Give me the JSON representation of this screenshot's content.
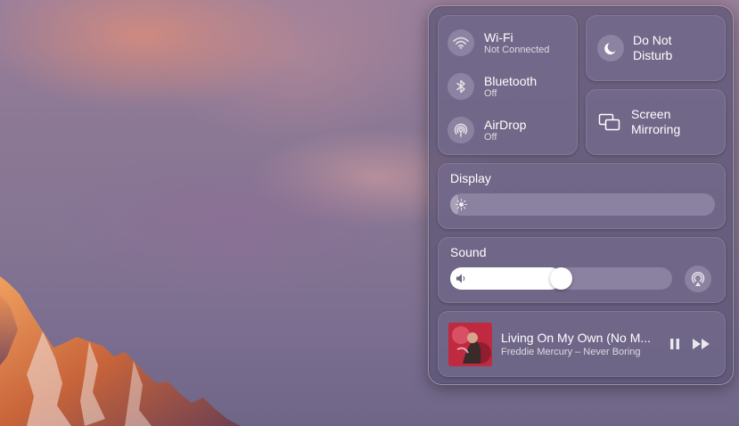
{
  "control_center": {
    "wifi": {
      "title": "Wi-Fi",
      "status": "Not Connected",
      "icon": "wifi-icon"
    },
    "bluetooth": {
      "title": "Bluetooth",
      "status": "Off",
      "icon": "bluetooth-icon"
    },
    "airdrop": {
      "title": "AirDrop",
      "status": "Off",
      "icon": "airdrop-icon"
    },
    "do_not_disturb": {
      "label_line1": "Do Not",
      "label_line2": "Disturb",
      "icon": "moon-icon"
    },
    "screen_mirroring": {
      "label_line1": "Screen",
      "label_line2": "Mirroring",
      "icon": "screen-mirroring-icon"
    },
    "display": {
      "title": "Display",
      "brightness_percent": 3,
      "icon": "sun-icon"
    },
    "sound": {
      "title": "Sound",
      "volume_percent": 50,
      "icon": "speaker-icon",
      "airplay_icon": "airplay-audio-icon"
    },
    "now_playing": {
      "track": "Living On My Own (No M...",
      "artist_album": "Freddie Mercury – Never Boring",
      "pause_icon": "pause-icon",
      "forward_icon": "fast-forward-icon"
    }
  },
  "colors": {
    "panel_bg": "#5c5474",
    "module_bg": "#787091",
    "slider_fill": "#ffffff",
    "text": "#ffffff"
  }
}
